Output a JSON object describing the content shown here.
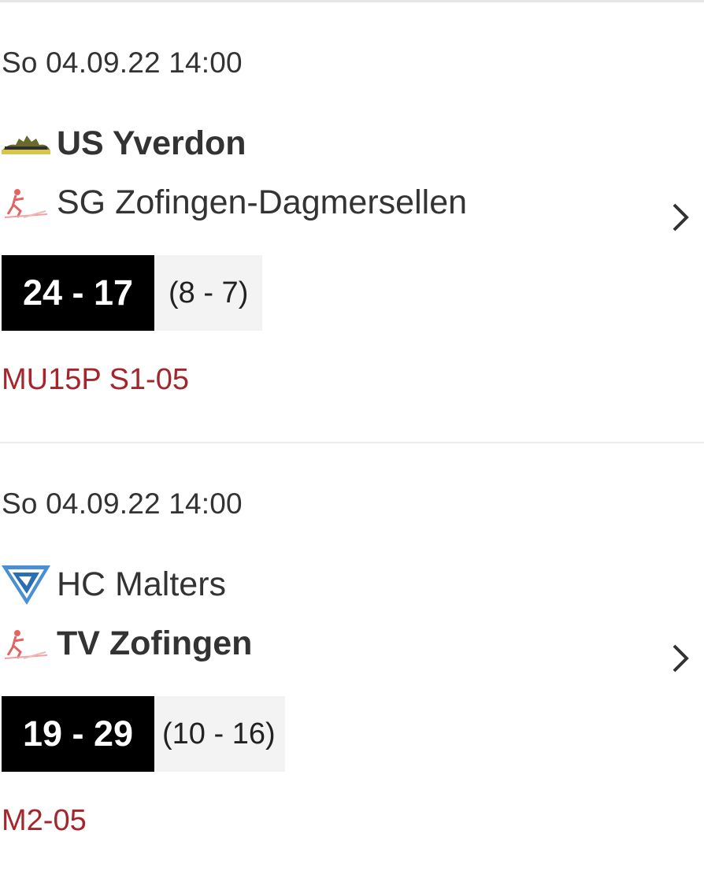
{
  "matches": [
    {
      "datetime": "So 04.09.22 14:00",
      "home": {
        "name": "US Yverdon",
        "bold": true,
        "logo": "us-yverdon-logo-icon"
      },
      "away": {
        "name": "SG Zofingen-Dagmersellen",
        "bold": false,
        "logo": "zofingen-handball-logo-icon"
      },
      "score": "24 - 17",
      "halftime": "(8 - 7)",
      "league": "MU15P S1-05"
    },
    {
      "datetime": "So 04.09.22 14:00",
      "home": {
        "name": "HC Malters",
        "bold": false,
        "logo": "hc-malters-logo-icon"
      },
      "away": {
        "name": "TV Zofingen",
        "bold": true,
        "logo": "zofingen-handball-logo-icon"
      },
      "score": "19 - 29",
      "halftime": "(10 - 16)",
      "league": "M2-05"
    }
  ],
  "icons": {
    "chevron": "chevron-right-icon"
  },
  "colors": {
    "league": "#a4262c",
    "score_bg": "#000000",
    "halftime_bg": "#f3f3f3"
  }
}
